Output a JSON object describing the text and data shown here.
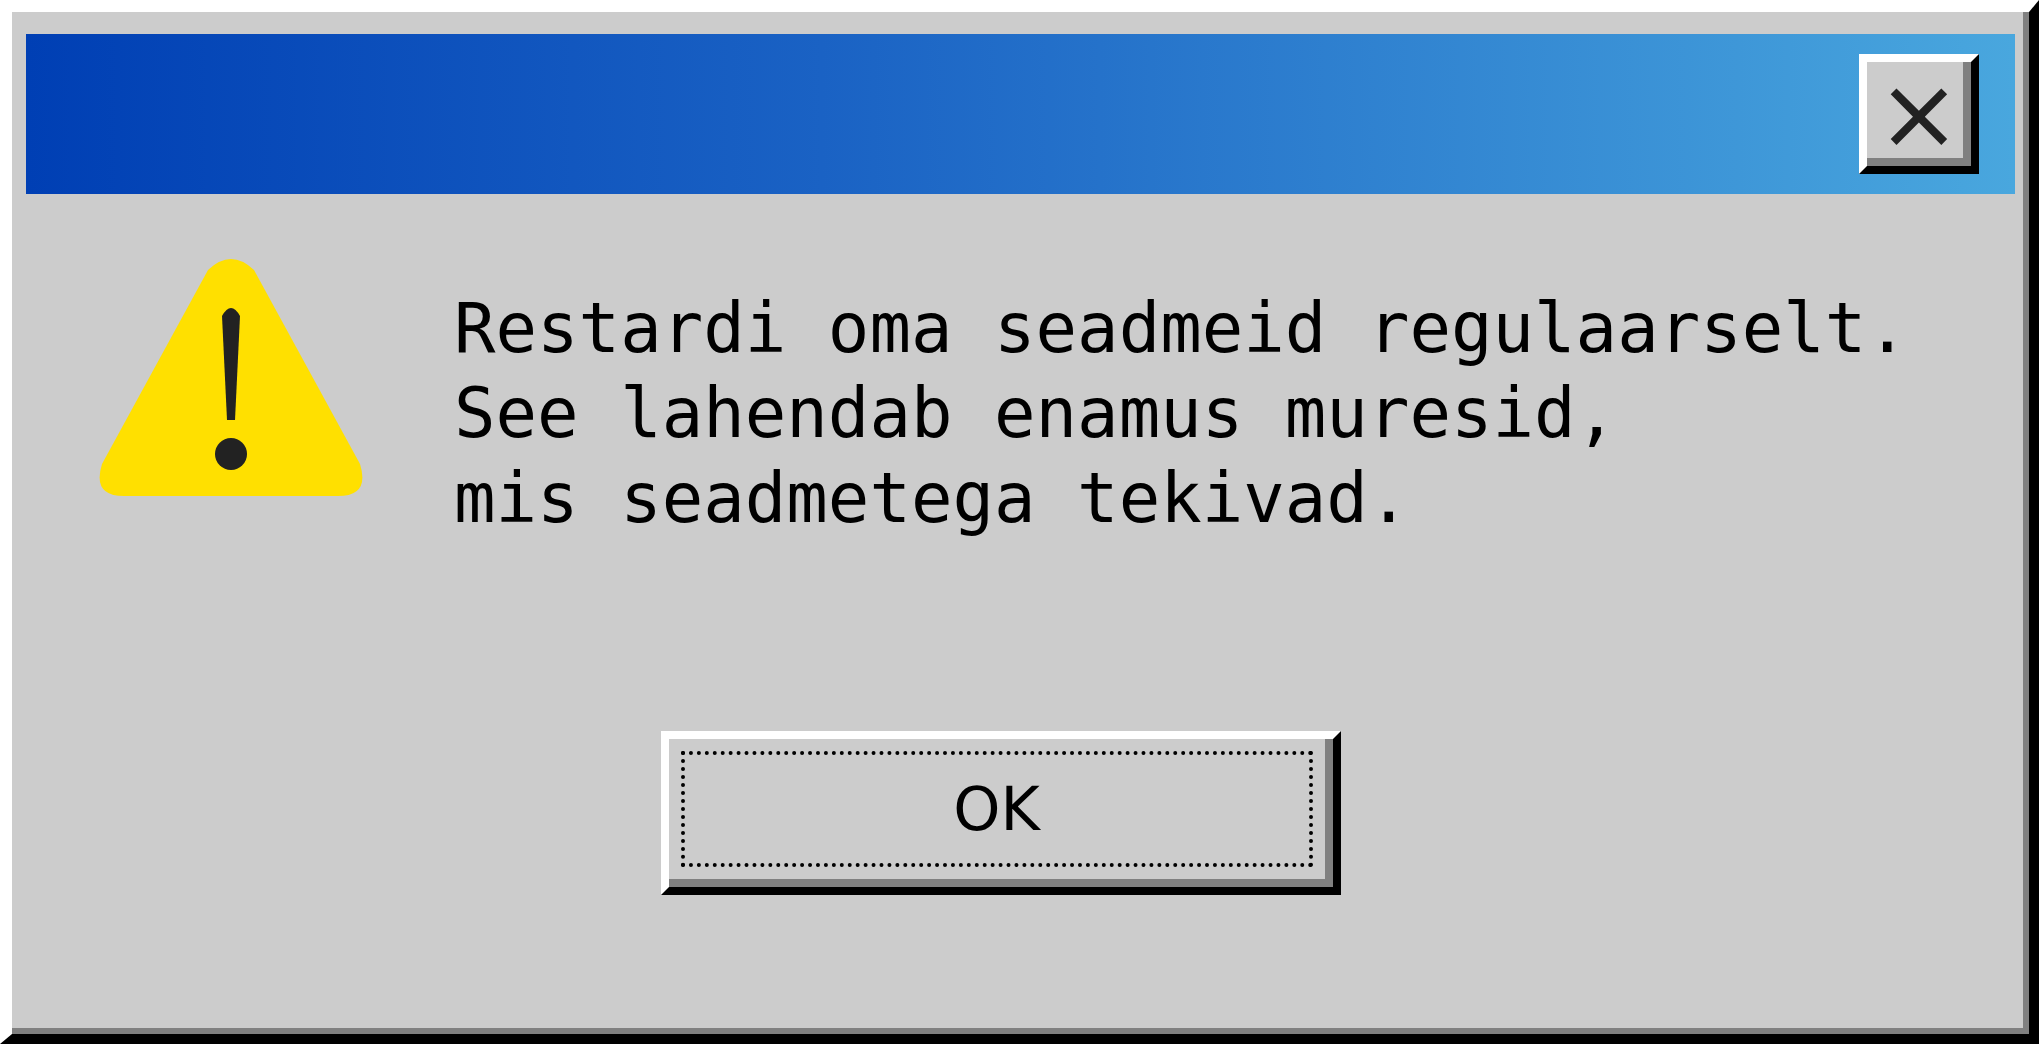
{
  "dialog": {
    "close_button": "×",
    "message": "Restardi oma seadmeid regulaarselt.\nSee lahendab enamus muresid,\nmis seadmetega tekivad.",
    "buttons": [
      {
        "label": "OK",
        "focused": true
      }
    ]
  }
}
